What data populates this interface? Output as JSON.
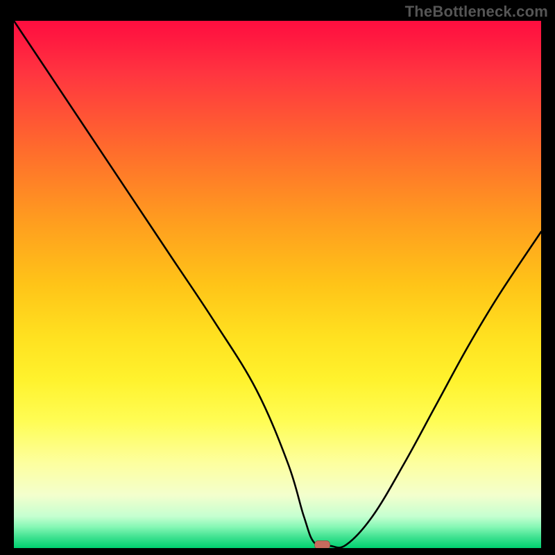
{
  "watermark": "TheBottleneck.com",
  "chart_data": {
    "type": "line",
    "title": "",
    "xlabel": "",
    "ylabel": "",
    "xlim": [
      0,
      100
    ],
    "ylim": [
      0,
      100
    ],
    "grid": false,
    "legend": false,
    "annotations": [],
    "series": [
      {
        "name": "bottleneck-curve",
        "x": [
          0,
          6,
          14,
          22,
          30,
          38,
          46,
          52,
          55,
          57,
          60,
          63,
          68,
          74,
          80,
          86,
          92,
          100
        ],
        "values": [
          100,
          91,
          79,
          67,
          55,
          43,
          30,
          16,
          6,
          1,
          0.4,
          0.6,
          6,
          16,
          27,
          38,
          48,
          60
        ]
      }
    ],
    "marker": {
      "name": "optimal-point",
      "x": 58.5,
      "y": 0.6,
      "color": "#c66b5e"
    },
    "background_gradient": {
      "stops": [
        {
          "pos": 0.0,
          "color": "#ff0e3f"
        },
        {
          "pos": 0.24,
          "color": "#ff6a2d"
        },
        {
          "pos": 0.5,
          "color": "#ffc418"
        },
        {
          "pos": 0.76,
          "color": "#fffd55"
        },
        {
          "pos": 0.94,
          "color": "#c5ffd0"
        },
        {
          "pos": 1.0,
          "color": "#00d070"
        }
      ]
    }
  }
}
